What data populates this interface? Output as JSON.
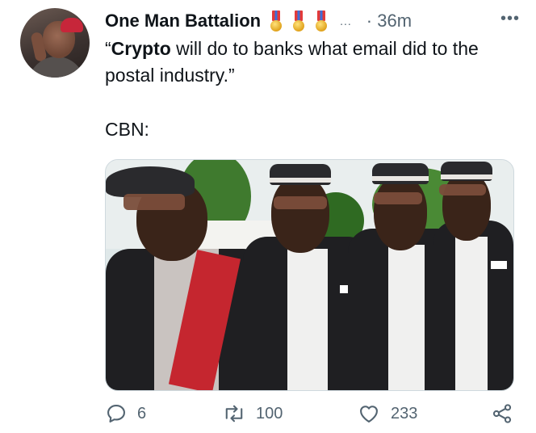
{
  "tweet": {
    "author_name": "One Man Battalion",
    "badge_icons": [
      "medal-icon",
      "medal-icon",
      "medal-icon"
    ],
    "truncation": "...",
    "time": "· 36m",
    "more_label": "•••",
    "text_bold": "Crypto",
    "text_open_quote": "“",
    "text_rest": " will do to banks what email did to the postal industry.”",
    "text_second": "CBN:"
  },
  "actions": {
    "reply_count": "6",
    "retweet_count": "100",
    "like_count": "233"
  },
  "colors": {
    "text_primary": "#0f1419",
    "text_secondary": "#536471",
    "border": "#cfd9de"
  }
}
